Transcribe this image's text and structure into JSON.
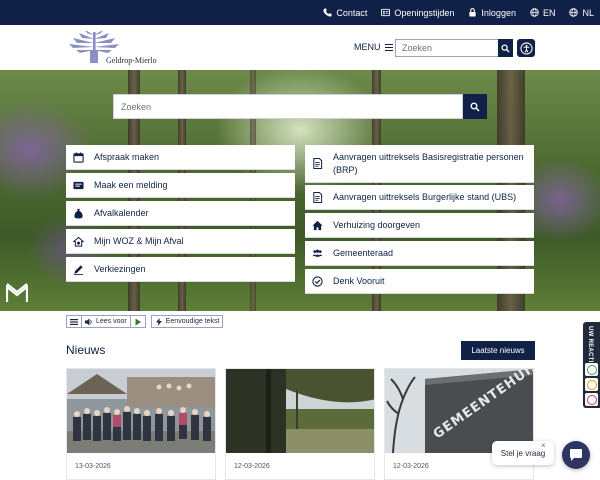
{
  "topbar": {
    "links": [
      {
        "label": "Contact",
        "icon": "phone-icon"
      },
      {
        "label": "Openingstijden",
        "icon": "id-card-icon"
      },
      {
        "label": "Inloggen",
        "icon": "lock-icon"
      },
      {
        "label": "EN",
        "icon": "globe-icon"
      },
      {
        "label": "NL",
        "icon": "globe-icon"
      }
    ]
  },
  "header": {
    "logo_text": "Geldrop-Mierlo",
    "menu_label": "MENU",
    "search_placeholder": "Zoeken"
  },
  "hero": {
    "search_placeholder": "Zoeken",
    "tiles_left": [
      {
        "label": "Afspraak maken",
        "icon": "calendar-icon"
      },
      {
        "label": "Maak een melding",
        "icon": "message-icon"
      },
      {
        "label": "Afvalkalender",
        "icon": "trash-bag-icon"
      },
      {
        "label": "Mijn WOZ & Mijn Afval",
        "icon": "house-cog-icon"
      },
      {
        "label": "Verkiezingen",
        "icon": "pencil-icon"
      }
    ],
    "tiles_right": [
      {
        "label": "Aanvragen uittreksels Basisregistratie personen (BRP)",
        "icon": "document-icon"
      },
      {
        "label": "Aanvragen uittreksels Burgerlijke stand (UBS)",
        "icon": "document-icon"
      },
      {
        "label": "Verhuizing doorgeven",
        "icon": "home-icon"
      },
      {
        "label": "Gemeenteraad",
        "icon": "people-icon"
      },
      {
        "label": "Denk Vooruit",
        "icon": "check-circle-icon"
      }
    ]
  },
  "readbar": {
    "read_label": "Lees voor",
    "simple_label": "Eenvoudige tekst"
  },
  "news": {
    "title": "Nieuws",
    "button_label": "Laatste nieuws",
    "items": [
      {
        "date": "13-03-2026"
      },
      {
        "date": "12-03-2026"
      },
      {
        "date": "12-03-2026",
        "image_text": "GEMEENTEHUIS"
      }
    ]
  },
  "feedback": {
    "label": "UW REACTIE"
  },
  "chat": {
    "bubble_label": "Stel je vraag",
    "close_label": "×"
  },
  "colors": {
    "brand_navy": "#0f2146",
    "logo_purple": "#8a8fc7"
  }
}
